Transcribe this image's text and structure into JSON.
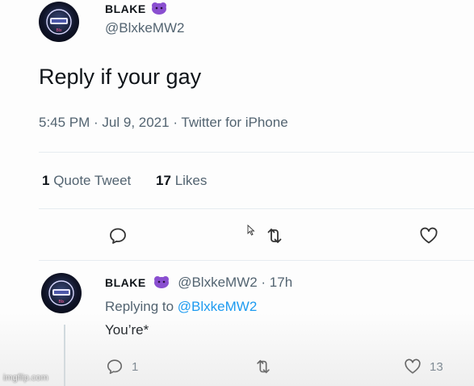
{
  "main_tweet": {
    "display_name": "BLAKE",
    "handle": "@BlxkeMW2",
    "emoji_icon": "purple-blob-emoji",
    "text": "Reply if your gay",
    "meta": "5:45 PM · Jul 9, 2021 · Twitter for iPhone",
    "stats": {
      "quote_count": "1",
      "quote_label": "Quote Tweet",
      "likes_count": "17",
      "likes_label": "Likes"
    },
    "actions": [
      "reply-icon",
      "retweet-icon",
      "like-icon"
    ]
  },
  "reply_tweet": {
    "display_name": "BLAKE",
    "handle_time": "@BlxkeMW2 · 17h",
    "replying_prefix": "Replying to",
    "replying_handle": "@BlxkeMW2",
    "text": "You’re*",
    "reply_count": "1",
    "like_count": "13",
    "actions": [
      "reply-icon",
      "retweet-icon",
      "like-icon"
    ]
  },
  "watermark": "imgflip.com",
  "colors": {
    "text": "#0f1419",
    "muted": "#536471",
    "link": "#1d9bf0",
    "emoji": "#8a4fd0"
  }
}
